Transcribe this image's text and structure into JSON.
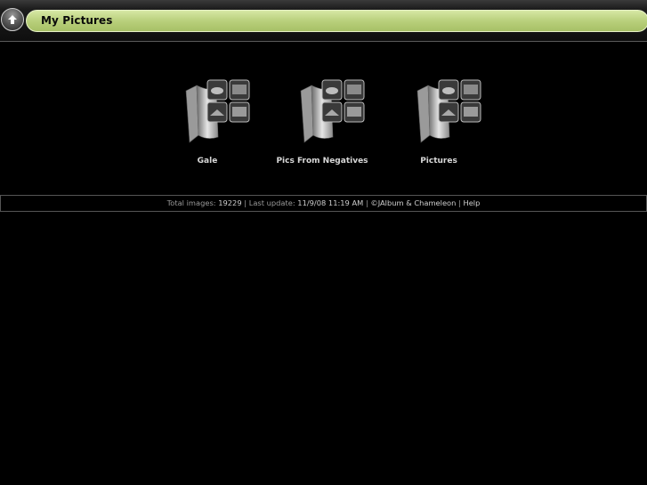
{
  "header": {
    "title": "My Pictures",
    "up_button_icon": "up-arrow-icon"
  },
  "albums": [
    {
      "label": "Gale",
      "icon": "album-folder-icon"
    },
    {
      "label": "Pics From Negatives",
      "icon": "album-folder-icon"
    },
    {
      "label": "Pictures",
      "icon": "album-folder-icon"
    }
  ],
  "footer": {
    "total_images_label": "Total images:",
    "total_images_value": "19229",
    "separator": "|",
    "last_update_label": "Last update:",
    "last_update_value": "11/9/08 11:19 AM",
    "credit_link": "©JAlbum & Chameleon",
    "help_link": "Help"
  },
  "colors": {
    "background": "#000000",
    "title_pill": "#b9d07c",
    "footer_text": "#9a9a9a"
  }
}
